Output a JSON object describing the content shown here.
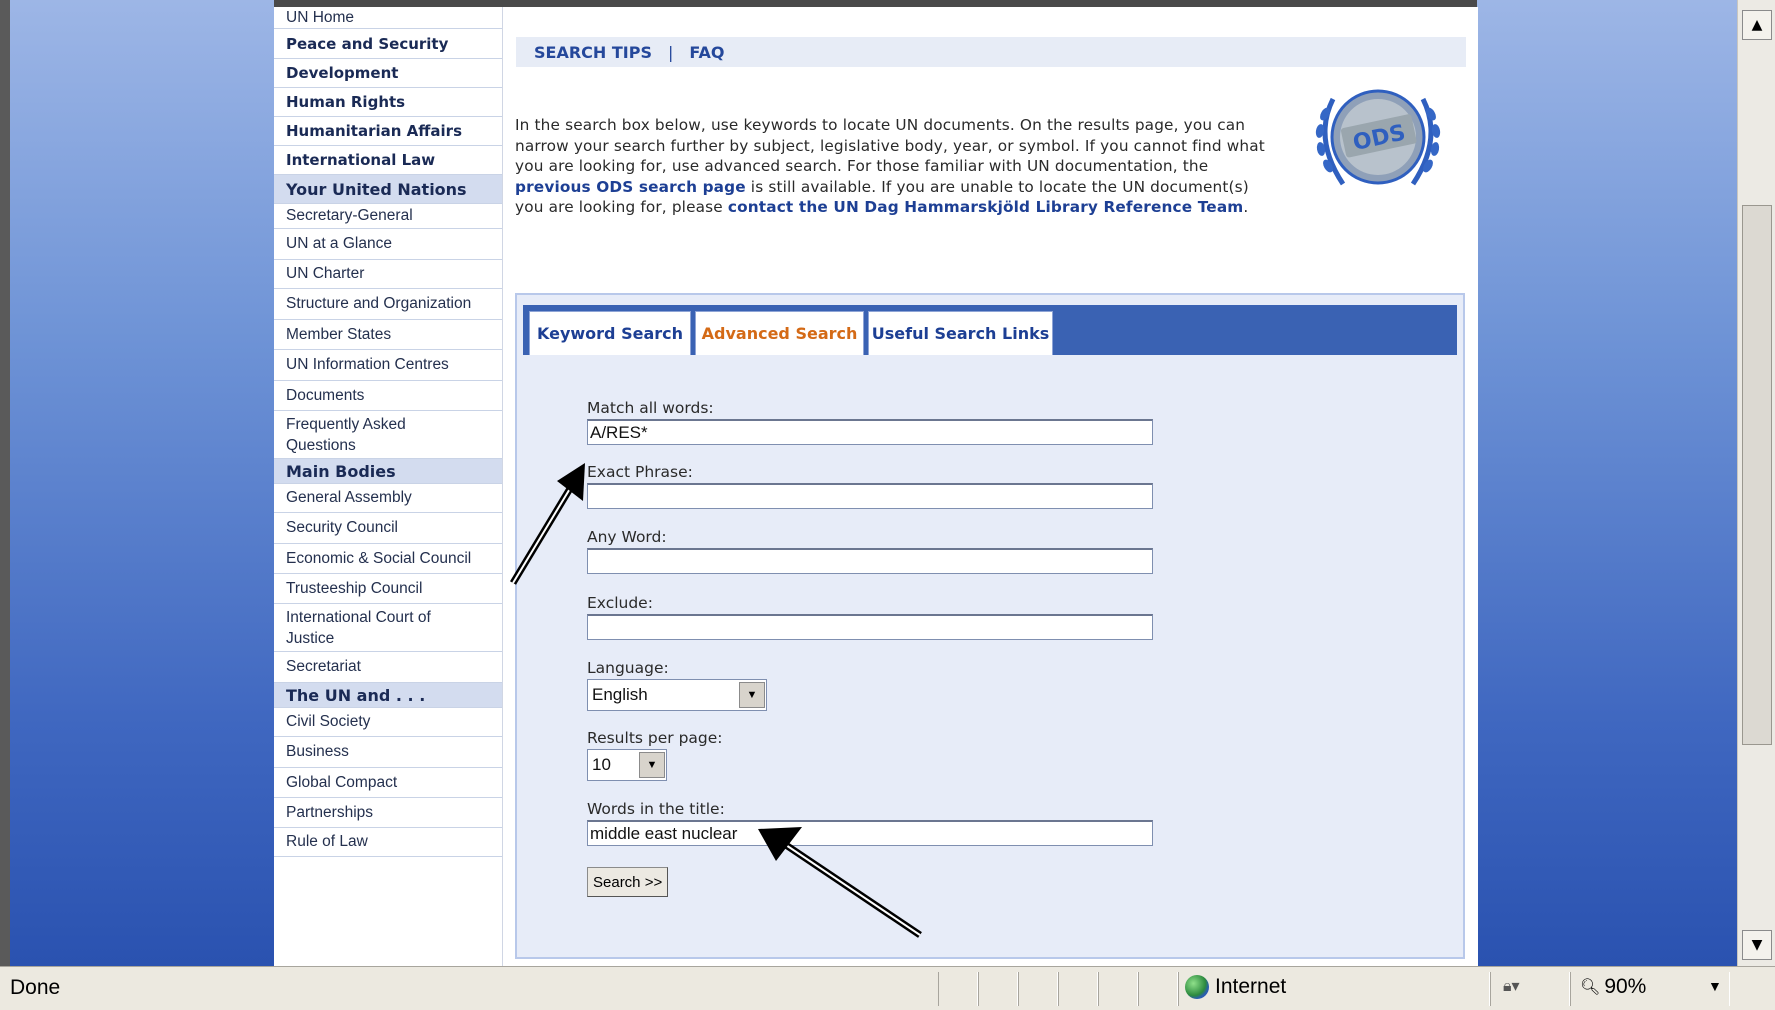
{
  "sidebar": {
    "items": [
      {
        "label": "UN Home",
        "kind": "plain"
      },
      {
        "label": "Peace and Security",
        "kind": "bold"
      },
      {
        "label": "Development",
        "kind": "bold"
      },
      {
        "label": "Human Rights",
        "kind": "bold"
      },
      {
        "label": "Humanitarian Affairs",
        "kind": "bold"
      },
      {
        "label": "International Law",
        "kind": "bold"
      },
      {
        "label": "Your United Nations",
        "kind": "head"
      },
      {
        "label": "Secretary-General",
        "kind": "plain"
      },
      {
        "label": "UN at a Glance",
        "kind": "plain"
      },
      {
        "label": "UN Charter",
        "kind": "plain"
      },
      {
        "label": "Structure and Organization",
        "kind": "plain"
      },
      {
        "label": "Member States",
        "kind": "plain"
      },
      {
        "label": "UN Information Centres",
        "kind": "plain"
      },
      {
        "label": "Documents",
        "kind": "plain"
      },
      {
        "label": "Frequently Asked Questions",
        "kind": "plain"
      },
      {
        "label": "Main Bodies",
        "kind": "head"
      },
      {
        "label": "General Assembly",
        "kind": "plain"
      },
      {
        "label": "Security Council",
        "kind": "plain"
      },
      {
        "label": "Economic & Social Council",
        "kind": "plain"
      },
      {
        "label": "Trusteeship Council",
        "kind": "plain"
      },
      {
        "label": "International Court of Justice",
        "kind": "plain"
      },
      {
        "label": "Secretariat",
        "kind": "plain"
      },
      {
        "label": "The UN and . . .",
        "kind": "head"
      },
      {
        "label": "Civil Society",
        "kind": "plain"
      },
      {
        "label": "Business",
        "kind": "plain"
      },
      {
        "label": "Global Compact",
        "kind": "plain"
      },
      {
        "label": "Partnerships",
        "kind": "plain"
      },
      {
        "label": "Rule of Law",
        "kind": "plain"
      }
    ]
  },
  "topnav": {
    "search_tips": "SEARCH TIPS",
    "separator": "|",
    "faq": "FAQ"
  },
  "intro": {
    "part1": "In the search box below, use keywords to locate UN documents. On the results page, you can narrow your search further by subject, legislative body, year, or symbol. If you cannot find what you are looking for, use advanced search. For those familiar with UN documentation, the ",
    "link1": "previous ODS search page",
    "part2": " is still available. If you are unable to locate the UN document(s) you are looking for, please ",
    "link2": "contact the UN Dag Hammarskjöld Library Reference Team",
    "part3": "."
  },
  "logo": {
    "text": "ODS"
  },
  "tabs": {
    "keyword": "Keyword Search",
    "advanced": "Advanced Search",
    "links": "Useful Search Links"
  },
  "form": {
    "match_all_label": "Match all words:",
    "match_all_value": "A/RES*",
    "exact_phrase_label": "Exact Phrase:",
    "exact_phrase_value": "",
    "any_word_label": "Any Word:",
    "any_word_value": "",
    "exclude_label": "Exclude:",
    "exclude_value": "",
    "language_label": "Language:",
    "language_value": "English",
    "results_label": "Results per page:",
    "results_value": "10",
    "title_words_label": "Words in the title:",
    "title_words_value": "middle east nuclear",
    "search_button": "Search >>"
  },
  "statusbar": {
    "status": "Done",
    "zone": "Internet",
    "zoom": "90%"
  },
  "colors": {
    "accent": "#3a62b3",
    "active_tab": "#d46a16",
    "link": "#1d3f94"
  }
}
